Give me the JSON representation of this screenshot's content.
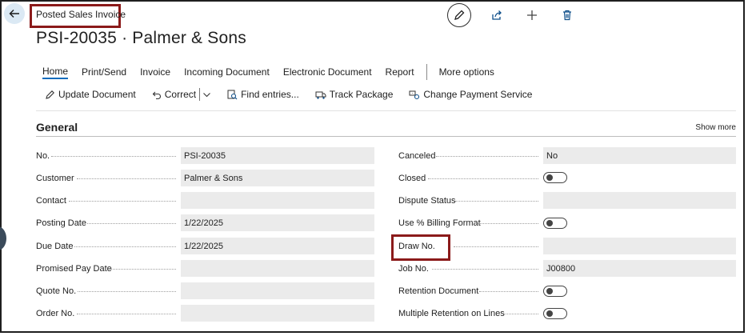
{
  "page": {
    "caption": "Posted Sales Invoice",
    "title": "PSI-20035 · Palmer & Sons"
  },
  "top_actions": [
    "edit-icon",
    "share-icon",
    "plus-icon",
    "delete-icon"
  ],
  "menu": {
    "items": [
      "Home",
      "Print/Send",
      "Invoice",
      "Incoming Document",
      "Electronic Document",
      "Report"
    ],
    "more": "More options",
    "active": "Home"
  },
  "actions": {
    "update_document": "Update Document",
    "correct": "Correct",
    "find_entries": "Find entries...",
    "track_package": "Track Package",
    "change_payment_service": "Change Payment Service"
  },
  "section": {
    "title": "General",
    "show_more": "Show more"
  },
  "left_fields": [
    {
      "label": "No.",
      "value": "PSI-20035"
    },
    {
      "label": "Customer",
      "value": "Palmer & Sons"
    },
    {
      "label": "Contact",
      "value": ""
    },
    {
      "label": "Posting Date",
      "value": "1/22/2025"
    },
    {
      "label": "Due Date",
      "value": "1/22/2025"
    },
    {
      "label": "Promised Pay Date",
      "value": ""
    },
    {
      "label": "Quote No.",
      "value": ""
    },
    {
      "label": "Order No.",
      "value": ""
    }
  ],
  "right_fields": [
    {
      "label": "Canceled",
      "value": "No"
    },
    {
      "label": "Closed",
      "toggle": false
    },
    {
      "label": "Dispute Status",
      "value": ""
    },
    {
      "label": "Use % Billing Format",
      "toggle": false
    },
    {
      "label": "Draw No.",
      "value": ""
    },
    {
      "label": "Job No.",
      "value": "J00800"
    },
    {
      "label": "Retention Document",
      "toggle": false
    },
    {
      "label": "Multiple Retention on Lines",
      "toggle": false
    }
  ],
  "colors": {
    "accent": "#0f6cbd",
    "highlight_border": "#8b1a1a",
    "field_background": "#ebebeb",
    "back_button_background": "#dbe9f4"
  }
}
